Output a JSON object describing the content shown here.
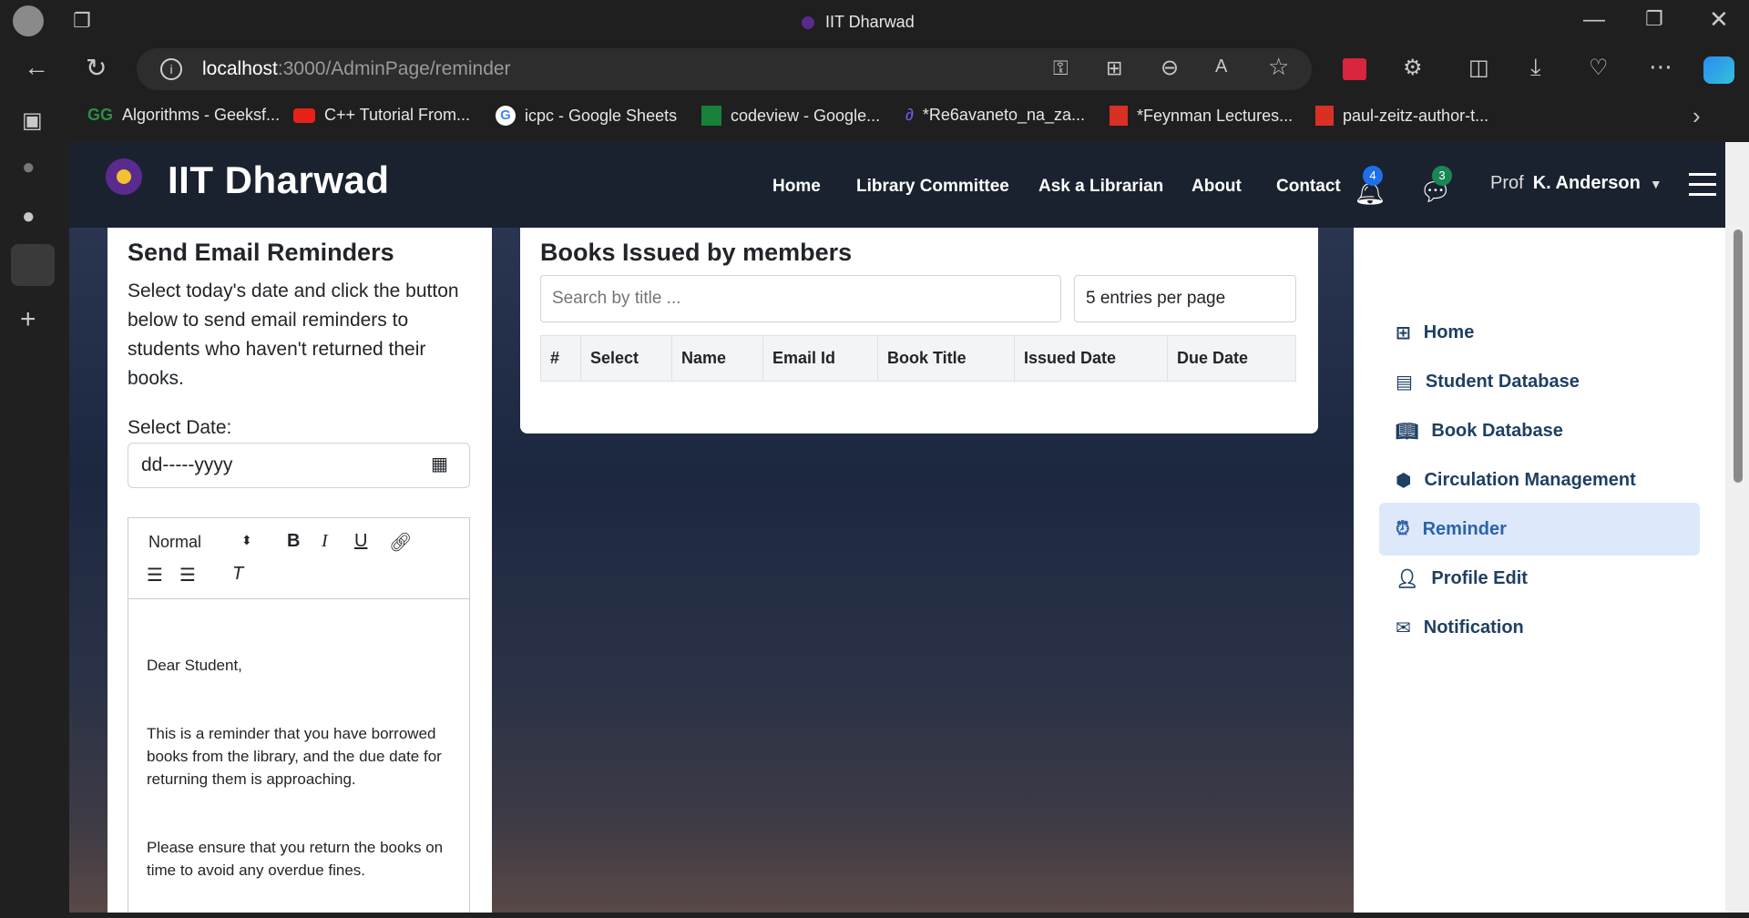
{
  "browser": {
    "tab_title": "IIT Dharwad",
    "url_host": "localhost",
    "url_path": ":3000/AdminPage/reminder",
    "bookmarks": [
      "Algorithms - Geeksf...",
      "C++ Tutorial From...",
      "icpc - Google Sheets",
      "codeview - Google...",
      "*Re6avaneto_na_za...",
      "*Feynman Lectures...",
      "paul-zeitz-author-t..."
    ]
  },
  "navbar": {
    "brand": "IIT Dharwad",
    "links": [
      "Home",
      "Library Committee",
      "Ask a Librarian",
      "About",
      "Contact"
    ],
    "notification_count": "4",
    "message_count": "3",
    "avatar_alt": "Prof",
    "user_name": "K. Anderson"
  },
  "reminder_panel": {
    "title": "Send Email Reminders",
    "description": "Select today's date and click the button below to send email reminders to students who haven't returned their books.",
    "date_label": "Select Date:",
    "date_placeholder": "dd-----yyyy",
    "editor_format": "Normal",
    "email_body": [
      "Dear Student,",
      "This is a reminder that you have borrowed books from the library, and the due date for returning them is approaching.",
      "Please ensure that you return the books on time to avoid any overdue fines."
    ]
  },
  "books_panel": {
    "title": "Books Issued by members",
    "search_placeholder": "Search by title ...",
    "entries_per_page": "5 entries per page",
    "columns": [
      "#",
      "Select",
      "Name",
      "Email Id",
      "Book Title",
      "Issued Date",
      "Due Date"
    ]
  },
  "sidebar": {
    "items": [
      {
        "label": "Home",
        "icon": "grid-icon"
      },
      {
        "label": "Student Database",
        "icon": "table-icon"
      },
      {
        "label": "Book Database",
        "icon": "book-icon"
      },
      {
        "label": "Circulation Management",
        "icon": "circle-icon"
      },
      {
        "label": "Reminder",
        "icon": "alarm-icon",
        "active": true
      },
      {
        "label": "Profile Edit",
        "icon": "person-icon"
      },
      {
        "label": "Notification",
        "icon": "envelope-icon"
      }
    ]
  },
  "colors": {
    "accent": "#2b63a8",
    "active_bg": "#dde8fb",
    "navbar": "#1a222f"
  }
}
